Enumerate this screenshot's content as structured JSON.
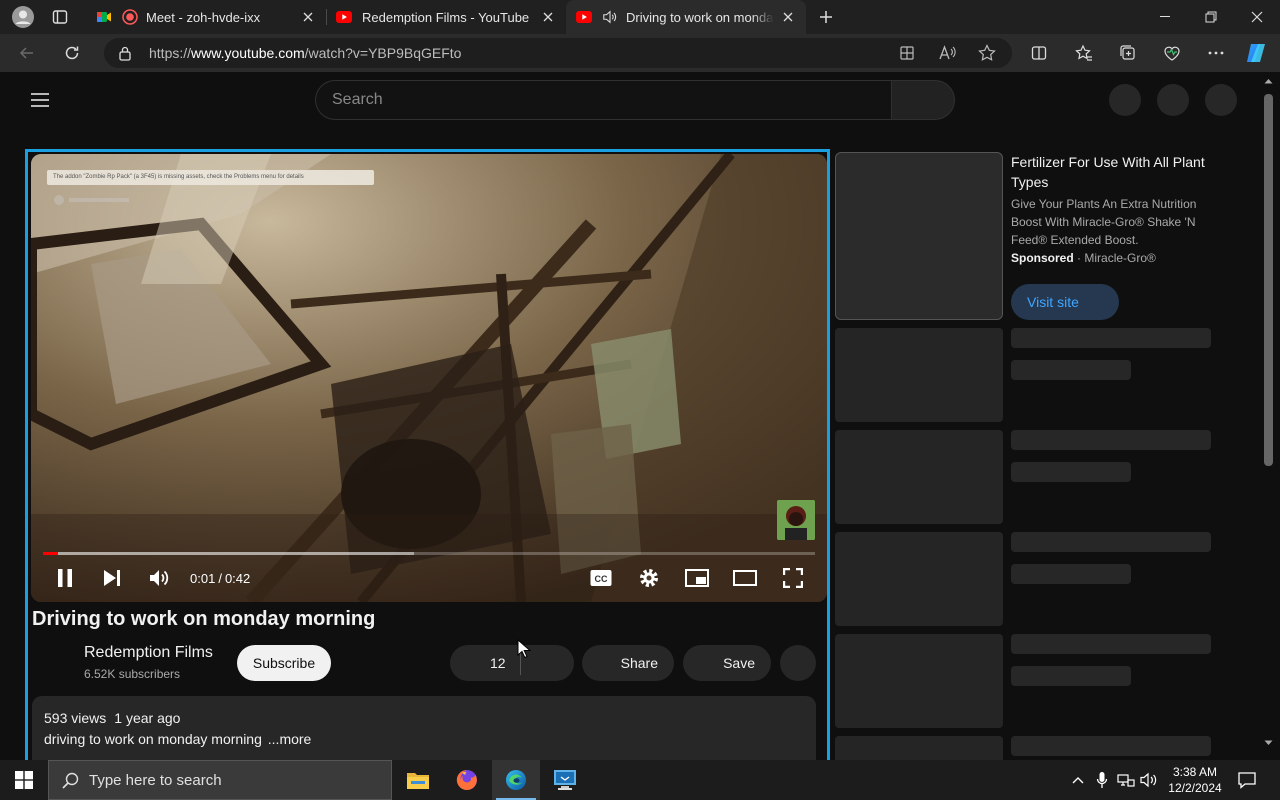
{
  "browser": {
    "tabs": [
      {
        "title": "Meet - zoh-hvde-ixx",
        "favicon": "google-meet-icon",
        "recording": true
      },
      {
        "title": "Redemption Films - YouTube",
        "favicon": "youtube-icon"
      },
      {
        "title": "Driving to work on monday morning",
        "favicon": "youtube-icon",
        "audio": true,
        "active": true
      }
    ],
    "url_prefix": "https://",
    "url_host": "www.youtube.com",
    "url_path": "/watch?v=YBP9BqGEFto"
  },
  "youtube": {
    "search_placeholder": "Search",
    "player": {
      "annotation_text": "The addon \"Zombie Rp Pack\" (a 3F45) is missing assets, check the Problems menu for details",
      "current_time": "0:01",
      "separator": "/",
      "duration": "0:42",
      "played_fraction": 0.02,
      "buffered_fraction": 0.48
    },
    "video": {
      "title": "Driving to work on monday morning",
      "channel": "Redemption Films",
      "subscribers": "6.52K subscribers",
      "subscribe_label": "Subscribe",
      "like_count": "12",
      "share_label": "Share",
      "save_label": "Save",
      "views": "593 views",
      "age": "1 year ago",
      "description": "driving to work on monday morning",
      "more_label": "...more"
    },
    "ad": {
      "title": "Fertilizer For Use With All Plant Types",
      "description": "Give Your Plants An Extra Nutrition Boost With Miracle-Gro® Shake 'N Feed® Extended Boost.",
      "sponsored_label": "Sponsored",
      "dot": "·",
      "advertiser": "Miracle-Gro®",
      "cta": "Visit site"
    }
  },
  "taskbar": {
    "search_placeholder": "Type here to search",
    "time": "3:38 AM",
    "date": "12/2/2024"
  },
  "colors": {
    "accent_frame": "#1aa0e0",
    "progress_red": "#ff0000",
    "link_blue": "#3ea6ff"
  }
}
